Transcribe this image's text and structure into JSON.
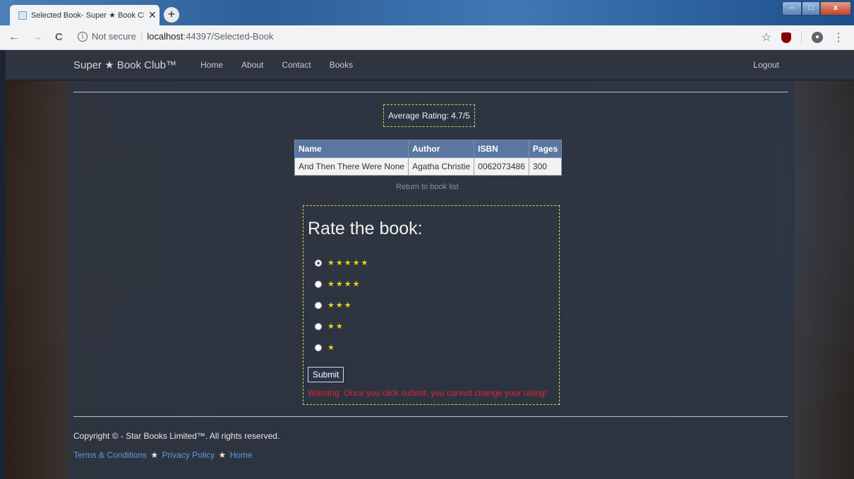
{
  "browser": {
    "tab_title": "Selected Book- Super ★ Book Cl",
    "tab_close": "✕",
    "new_tab": "+",
    "back": "←",
    "forward": "→",
    "reload": "C",
    "security_label": "Not secure",
    "url_host": "localhost",
    "url_path": ":44397/Selected-Book",
    "bookmark_icon": "☆",
    "menu_icon": "⋮"
  },
  "navbar": {
    "brand": "Super ★ Book Club™",
    "links": [
      "Home",
      "About",
      "Contact",
      "Books"
    ],
    "logout": "Logout"
  },
  "average_rating": "Average Rating: 4.7/5",
  "book_table": {
    "headers": [
      "Name",
      "Author",
      "ISBN",
      "Pages"
    ],
    "rows": [
      [
        "And Then There Were None",
        "Agatha Christie",
        "0062073486",
        "300"
      ]
    ]
  },
  "return_link": "Return to book list",
  "rating_form": {
    "title": "Rate the book:",
    "options": [
      "★★★★★",
      "★★★★",
      "★★★",
      "★★",
      "★"
    ],
    "selected_index": 0,
    "submit_label": "Submit",
    "warning": "Warning: Once you click submit, you cannot change your rating!"
  },
  "footer": {
    "copyright": "Copyright © - Star Books Limited™. All rights reserved.",
    "links": [
      "Terms & Conditions",
      "Privacy Policy",
      "Home"
    ],
    "separator": "★"
  },
  "colors": {
    "accent_blue": "#5b76a0",
    "star_yellow": "#f0d21a",
    "warning_red": "#e8232a",
    "link_blue": "#5a9be0"
  }
}
